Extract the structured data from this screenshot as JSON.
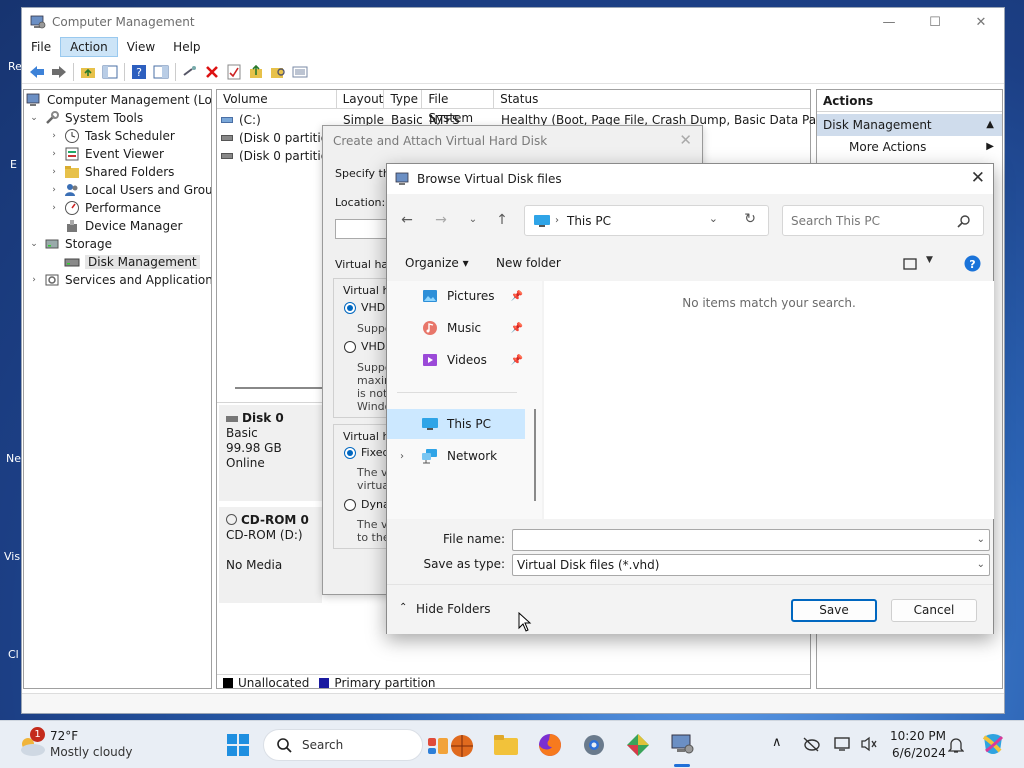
{
  "window": {
    "title": "Computer Management",
    "controls": {
      "minimize": "—",
      "maximize": "☐",
      "close": "✕"
    }
  },
  "menu": [
    "File",
    "Action",
    "View",
    "Help"
  ],
  "tree": {
    "root": "Computer Management (Local",
    "system_tools": "System Tools",
    "task_scheduler": "Task Scheduler",
    "event_viewer": "Event Viewer",
    "shared_folders": "Shared Folders",
    "local_users": "Local Users and Groups",
    "performance": "Performance",
    "device_manager": "Device Manager",
    "storage": "Storage",
    "disk_management": "Disk Management",
    "services": "Services and Applications"
  },
  "volumes": {
    "headers": [
      "Volume",
      "Layout",
      "Type",
      "File System",
      "Status"
    ],
    "rows": [
      {
        "volume": "(C:)",
        "layout": "Simple",
        "type": "Basic",
        "fs": "NTFS",
        "status": "Healthy (Boot, Page File, Crash Dump, Basic Data Partition)"
      },
      {
        "volume": "(Disk 0 partition"
      },
      {
        "volume": "(Disk 0 partition"
      }
    ]
  },
  "disks": [
    {
      "name": "Disk 0",
      "line1": "Basic",
      "line2": "99.98 GB",
      "line3": "Online"
    },
    {
      "name": "CD-ROM 0",
      "line1": "CD-ROM (D:)",
      "line2": "",
      "line3": "No Media"
    }
  ],
  "legend": {
    "unallocated": "Unallocated",
    "primary": "Primary partition"
  },
  "actions": {
    "header": "Actions",
    "section": "Disk Management",
    "more": "More Actions"
  },
  "create_dialog": {
    "title": "Create and Attach Virtual Hard Disk",
    "close": "✕",
    "specify": "Specify the",
    "location": "Location:",
    "vformat": "Virtual hard",
    "vformat2": "Virtual ha",
    "vhd": "VHD",
    "vhd_desc": "Suppo",
    "vhdx": "VHDX",
    "vhdx_desc": [
      "Suppo",
      "maxim",
      "is not s",
      "Windo"
    ],
    "vtype": "Virtual ha",
    "fixed": "Fixed",
    "fixed_desc": [
      "The vi",
      "virtual"
    ],
    "dynamic": "Dyna",
    "dynamic_desc": [
      "The vi",
      "to the"
    ]
  },
  "browse": {
    "title": "Browse Virtual Disk files",
    "close": "✕",
    "address": "This PC",
    "search_placeholder": "Search This PC",
    "organize": "Organize ▾",
    "new_folder": "New folder",
    "nav": {
      "pictures": "Pictures",
      "music": "Music",
      "videos": "Videos",
      "this_pc": "This PC",
      "network": "Network"
    },
    "empty_msg": "No items match your search.",
    "file_name_label": "File name:",
    "file_name_value": "",
    "save_type_label": "Save as type:",
    "save_type_value": "Virtual Disk files (*.vhd)",
    "hide_folders": "Hide Folders",
    "save": "Save",
    "cancel": "Cancel"
  },
  "desktop_frags": [
    "Re",
    "E",
    "Ne",
    "Vis",
    "Cl"
  ],
  "taskbar": {
    "badge": "1",
    "temp": "72°F",
    "weather": "Mostly cloudy",
    "search": "Search",
    "time": "10:20 PM",
    "date": "6/6/2024"
  },
  "colors": {
    "accent": "#0067c0",
    "unallocated": "#000000",
    "primary": "#1a1aa0"
  }
}
